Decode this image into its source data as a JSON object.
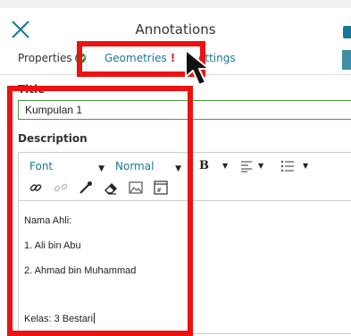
{
  "header": {
    "title": "Annotations"
  },
  "tabs": {
    "properties": "Properties",
    "geometries": "Geometries",
    "geometries_warning": "!",
    "settings": "ettings"
  },
  "form": {
    "title_label": "Title",
    "title_value": "Kumpulan 1",
    "description_label": "Description"
  },
  "toolbar": {
    "font": "Font",
    "size": "Normal",
    "bold": "B"
  },
  "description": {
    "lines": [
      "Nama Ahli:",
      "1. Ali bin Abu",
      "2. Ahmad bin Muhammad",
      "Kelas: 3 Bestari"
    ]
  },
  "colors": {
    "accent": "#1a7896",
    "highlight": "#ee1111",
    "ok": "#2e8b3c",
    "warning": "#d9232a"
  },
  "icons": [
    "close-icon",
    "pin-icon",
    "check-circle-icon",
    "link-icon",
    "unlink-icon",
    "eyedropper-icon",
    "eraser-icon",
    "image-icon",
    "code-icon",
    "align-icon",
    "list-icon",
    "mouse-pointer-icon"
  ]
}
